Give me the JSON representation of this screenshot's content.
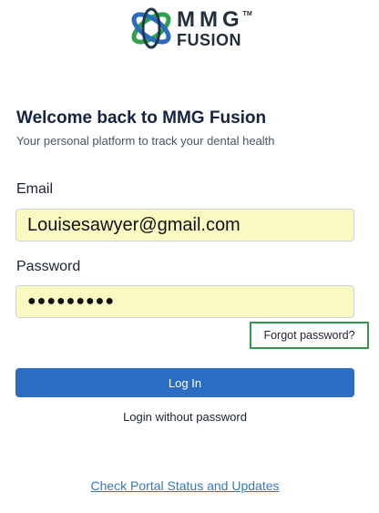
{
  "logo": {
    "line1": "MMG",
    "tm": "TM",
    "line2": "FUSION",
    "colors": [
      "#2fa24a",
      "#2b6dbd",
      "#1f3550"
    ]
  },
  "header": {
    "title": "Welcome back to MMG Fusion",
    "subtitle": "Your personal platform to track your dental health"
  },
  "form": {
    "email_label": "Email",
    "email_value": "Louisesawyer@gmail.com",
    "password_label": "Password",
    "password_value": "●●●●●●●●●",
    "forgot_label": "Forgot password?",
    "login_label": "Log In",
    "no_password_label": "Login without password"
  },
  "footer": {
    "status_link": "Check Portal Status and Updates"
  },
  "colors": {
    "accent": "#2c6dc4",
    "autofill_bg": "#fbf9c2",
    "highlight_border": "#2e9c47",
    "link": "#3579b9"
  }
}
